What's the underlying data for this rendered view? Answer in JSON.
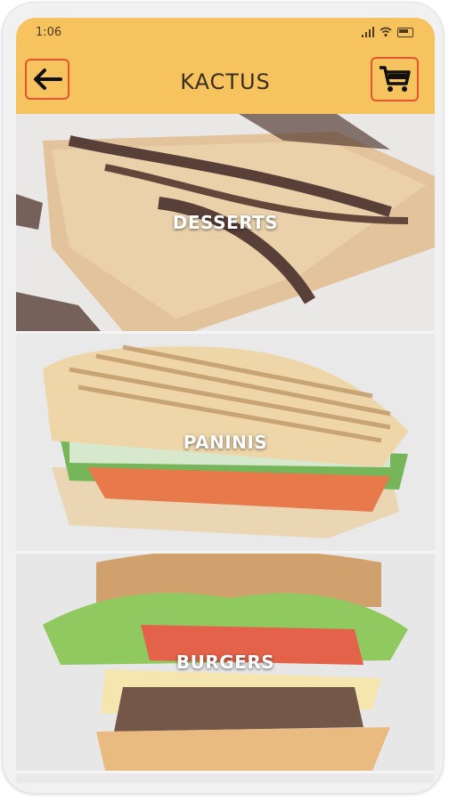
{
  "status": {
    "time": "1:06"
  },
  "header": {
    "title": "KACTUS"
  },
  "categories": [
    {
      "label": "DESSERTS"
    },
    {
      "label": "PANINIS"
    },
    {
      "label": "BURGERS"
    }
  ],
  "icons": {
    "back": "arrow-left-icon",
    "cart": "shopping-cart-icon"
  },
  "colors": {
    "appbar": "#f7c35f",
    "button_border": "#e4572e"
  }
}
